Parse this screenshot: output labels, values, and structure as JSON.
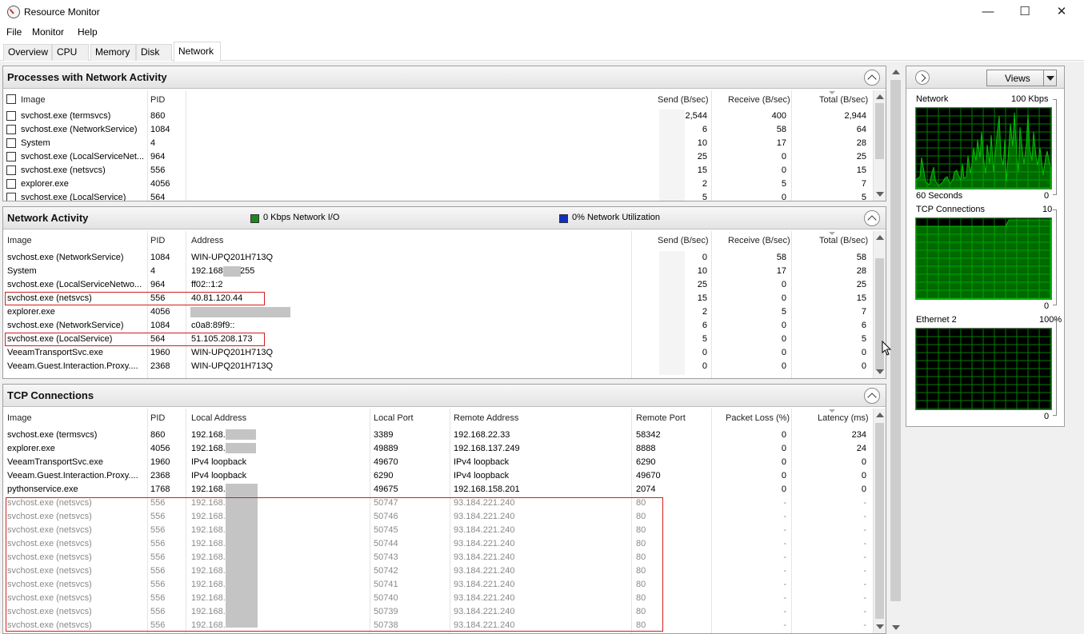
{
  "window": {
    "title": "Resource Monitor",
    "minimize": "—",
    "maximize": "☐",
    "close": "✕"
  },
  "menu": [
    "File",
    "Monitor",
    "Help"
  ],
  "tabs": [
    "Overview",
    "CPU",
    "Memory",
    "Disk",
    "Network"
  ],
  "active_tab": "Network",
  "processes": {
    "title": "Processes with Network Activity",
    "columns": [
      "Image",
      "PID",
      "Send (B/sec)",
      "Receive (B/sec)",
      "Total (B/sec)"
    ],
    "rows": [
      {
        "image": "svchost.exe (termsvcs)",
        "pid": "860",
        "send": "2,544",
        "receive": "400",
        "total": "2,944"
      },
      {
        "image": "svchost.exe (NetworkService)",
        "pid": "1084",
        "send": "6",
        "receive": "58",
        "total": "64"
      },
      {
        "image": "System",
        "pid": "4",
        "send": "10",
        "receive": "17",
        "total": "28"
      },
      {
        "image": "svchost.exe (LocalServiceNet...",
        "pid": "964",
        "send": "25",
        "receive": "0",
        "total": "25"
      },
      {
        "image": "svchost.exe (netsvcs)",
        "pid": "556",
        "send": "15",
        "receive": "0",
        "total": "15"
      },
      {
        "image": "explorer.exe",
        "pid": "4056",
        "send": "2",
        "receive": "5",
        "total": "7"
      },
      {
        "image": "svchost.exe (LocalService)",
        "pid": "564",
        "send": "5",
        "receive": "0",
        "total": "5"
      }
    ]
  },
  "network_activity": {
    "title": "Network Activity",
    "io_legend": "0 Kbps Network I/O",
    "util_legend": "0% Network Utilization",
    "io_color": "#1a8a1a",
    "util_color": "#1030c0",
    "columns": [
      "Image",
      "PID",
      "Address",
      "Send (B/sec)",
      "Receive (B/sec)",
      "Total (B/sec)"
    ],
    "rows": [
      {
        "image": "svchost.exe (NetworkService)",
        "pid": "1084",
        "address": "WIN-UPQ201H713Q",
        "send": "0",
        "receive": "58",
        "total": "58"
      },
      {
        "image": "System",
        "pid": "4",
        "address": "192.168.",
        "address_suffix": "255",
        "send": "10",
        "receive": "17",
        "total": "28"
      },
      {
        "image": "svchost.exe (LocalServiceNetwo...",
        "pid": "964",
        "address": "ff02::1:2",
        "send": "25",
        "receive": "0",
        "total": "25"
      },
      {
        "image": "svchost.exe (netsvcs)",
        "pid": "556",
        "address": "40.81.120.44",
        "send": "15",
        "receive": "0",
        "total": "15"
      },
      {
        "image": "explorer.exe",
        "pid": "4056",
        "address": "",
        "send": "2",
        "receive": "5",
        "total": "7"
      },
      {
        "image": "svchost.exe (NetworkService)",
        "pid": "1084",
        "address": "c0a8:89f9::",
        "send": "6",
        "receive": "0",
        "total": "6"
      },
      {
        "image": "svchost.exe (LocalService)",
        "pid": "564",
        "address": "51.105.208.173",
        "send": "5",
        "receive": "0",
        "total": "5"
      },
      {
        "image": "VeeamTransportSvc.exe",
        "pid": "1960",
        "address": "WIN-UPQ201H713Q",
        "send": "0",
        "receive": "0",
        "total": "0"
      },
      {
        "image": "Veeam.Guest.Interaction.Proxy....",
        "pid": "2368",
        "address": "WIN-UPQ201H713Q",
        "send": "0",
        "receive": "0",
        "total": "0"
      }
    ]
  },
  "tcp": {
    "title": "TCP Connections",
    "columns": [
      "Image",
      "PID",
      "Local Address",
      "Local Port",
      "Remote Address",
      "Remote Port",
      "Packet Loss (%)",
      "Latency (ms)"
    ],
    "rows": [
      {
        "image": "svchost.exe (termsvcs)",
        "pid": "860",
        "local": "192.168.",
        "lport": "3389",
        "remote": "192.168.22.33",
        "rport": "58342",
        "loss": "0",
        "latency": "234"
      },
      {
        "image": "explorer.exe",
        "pid": "4056",
        "local": "192.168.",
        "lport": "49889",
        "remote": "192.168.137.249",
        "rport": "8888",
        "loss": "0",
        "latency": "24"
      },
      {
        "image": "VeeamTransportSvc.exe",
        "pid": "1960",
        "local": "IPv4 loopback",
        "lport": "49670",
        "remote": "IPv4 loopback",
        "rport": "6290",
        "loss": "0",
        "latency": "0"
      },
      {
        "image": "Veeam.Guest.Interaction.Proxy....",
        "pid": "2368",
        "local": "IPv4 loopback",
        "lport": "6290",
        "remote": "IPv4 loopback",
        "rport": "49670",
        "loss": "0",
        "latency": "0"
      },
      {
        "image": "pythonservice.exe",
        "pid": "1768",
        "local": "192.168.",
        "lport": "49675",
        "remote": "192.168.158.201",
        "rport": "2074",
        "loss": "0",
        "latency": "0"
      },
      {
        "image": "svchost.exe (netsvcs)",
        "pid": "556",
        "local": "192.168.",
        "lport": "50747",
        "remote": "93.184.221.240",
        "rport": "80",
        "loss": "-",
        "latency": "-"
      },
      {
        "image": "svchost.exe (netsvcs)",
        "pid": "556",
        "local": "192.168.",
        "lport": "50746",
        "remote": "93.184.221.240",
        "rport": "80",
        "loss": "-",
        "latency": "-"
      },
      {
        "image": "svchost.exe (netsvcs)",
        "pid": "556",
        "local": "192.168.",
        "lport": "50745",
        "remote": "93.184.221.240",
        "rport": "80",
        "loss": "-",
        "latency": "-"
      },
      {
        "image": "svchost.exe (netsvcs)",
        "pid": "556",
        "local": "192.168.",
        "lport": "50744",
        "remote": "93.184.221.240",
        "rport": "80",
        "loss": "-",
        "latency": "-"
      },
      {
        "image": "svchost.exe (netsvcs)",
        "pid": "556",
        "local": "192.168.",
        "lport": "50743",
        "remote": "93.184.221.240",
        "rport": "80",
        "loss": "-",
        "latency": "-"
      },
      {
        "image": "svchost.exe (netsvcs)",
        "pid": "556",
        "local": "192.168.",
        "lport": "50742",
        "remote": "93.184.221.240",
        "rport": "80",
        "loss": "-",
        "latency": "-"
      },
      {
        "image": "svchost.exe (netsvcs)",
        "pid": "556",
        "local": "192.168.",
        "lport": "50741",
        "remote": "93.184.221.240",
        "rport": "80",
        "loss": "-",
        "latency": "-"
      },
      {
        "image": "svchost.exe (netsvcs)",
        "pid": "556",
        "local": "192.168.",
        "lport": "50740",
        "remote": "93.184.221.240",
        "rport": "80",
        "loss": "-",
        "latency": "-"
      },
      {
        "image": "svchost.exe (netsvcs)",
        "pid": "556",
        "local": "192.168.",
        "lport": "50739",
        "remote": "93.184.221.240",
        "rport": "80",
        "loss": "-",
        "latency": "-"
      },
      {
        "image": "svchost.exe (netsvcs)",
        "pid": "556",
        "local": "192.168.",
        "lport": "50738",
        "remote": "93.184.221.240",
        "rport": "80",
        "loss": "-",
        "latency": "-"
      }
    ]
  },
  "side": {
    "views_label": "Views",
    "graphs": [
      {
        "name": "Network",
        "max": "100 Kbps",
        "footer": "60 Seconds",
        "min": "0"
      },
      {
        "name": "TCP Connections",
        "max": "10",
        "min": "0"
      },
      {
        "name": "Ethernet 2",
        "max": "100%",
        "min": "0"
      }
    ],
    "graph_color": "#00c000",
    "grid_color": "#008000"
  }
}
